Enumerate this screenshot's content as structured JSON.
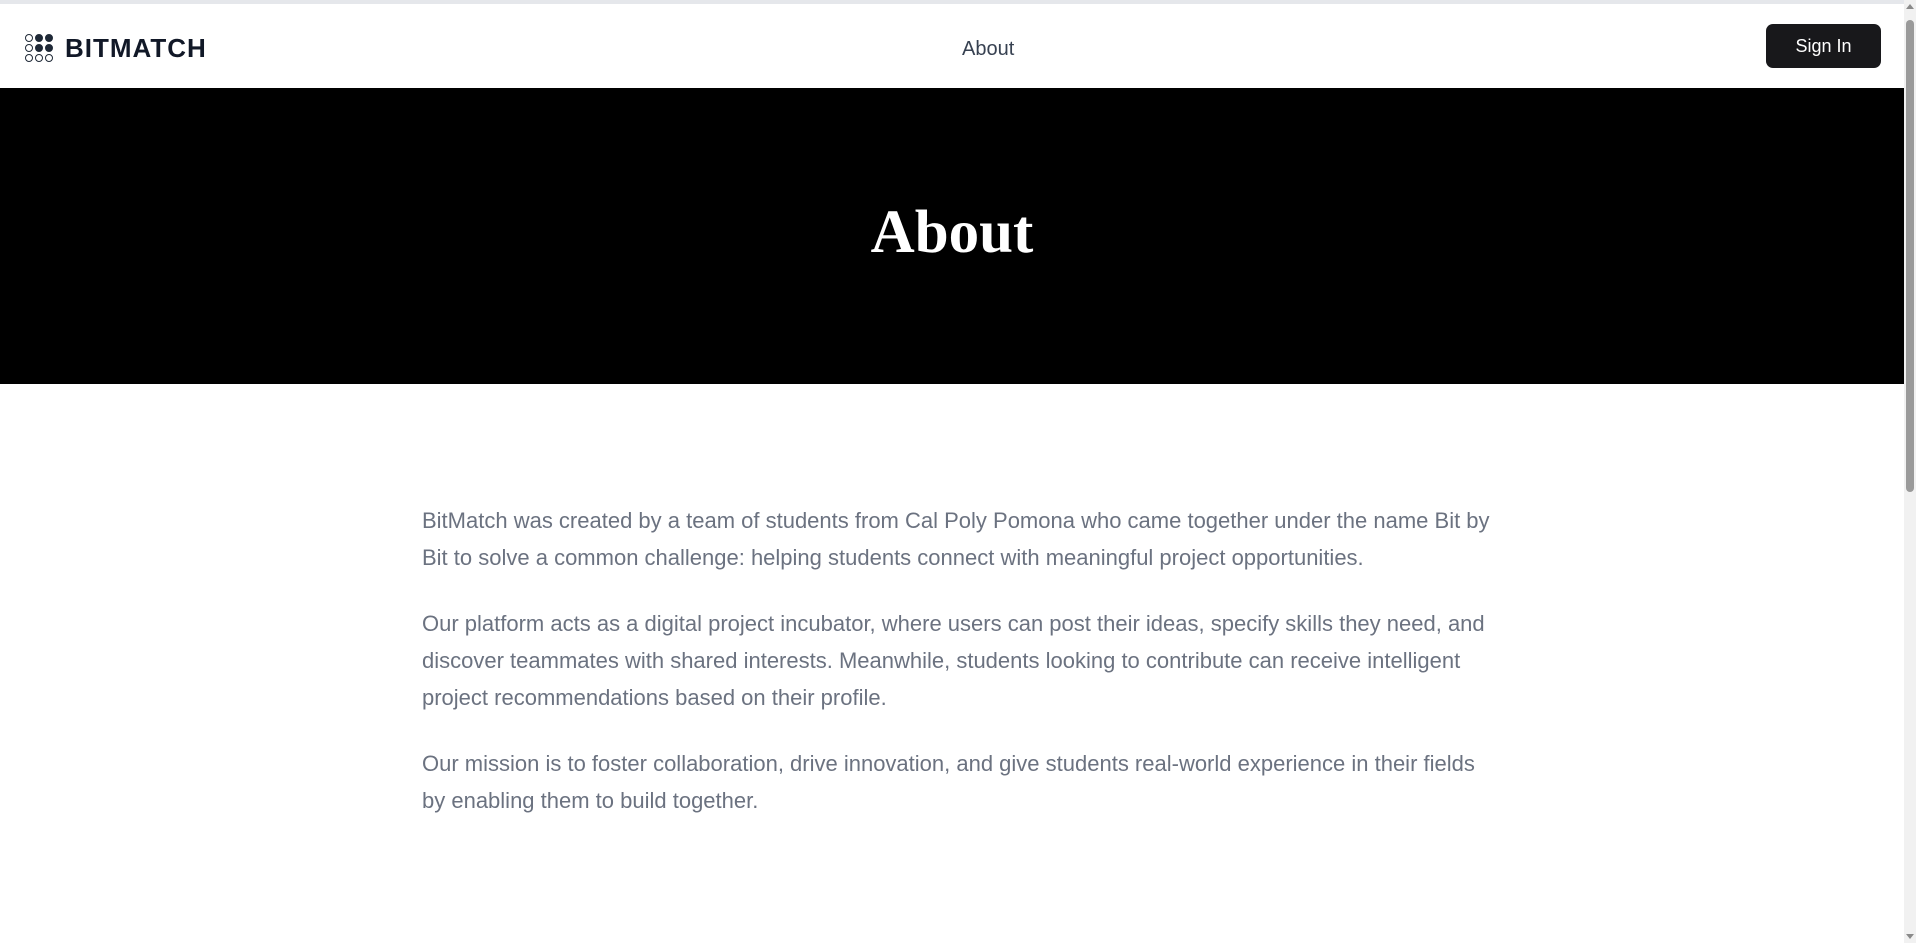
{
  "header": {
    "brand": "BITMATCH",
    "logo_icon": "grid-dots-icon",
    "nav": [
      {
        "label": "About"
      }
    ],
    "sign_in_label": "Sign In"
  },
  "hero": {
    "title": "About",
    "background": "#000000"
  },
  "content": {
    "paragraphs": [
      "BitMatch was created by a team of students from Cal Poly Pomona who came together under the name Bit by Bit to solve a common challenge: helping students connect with meaningful project opportunities.",
      "Our platform acts as a digital project incubator, where users can post their ideas, specify skills they need, and discover teammates with shared interests. Meanwhile, students looking to contribute can receive intelligent project recommendations based on their profile.",
      "Our mission is to foster collaboration, drive innovation, and give students real-world experience in their fields by enabling them to build together."
    ]
  },
  "colors": {
    "brand_text": "#111827",
    "button_bg": "#18181b",
    "body_text": "#6b7280"
  }
}
